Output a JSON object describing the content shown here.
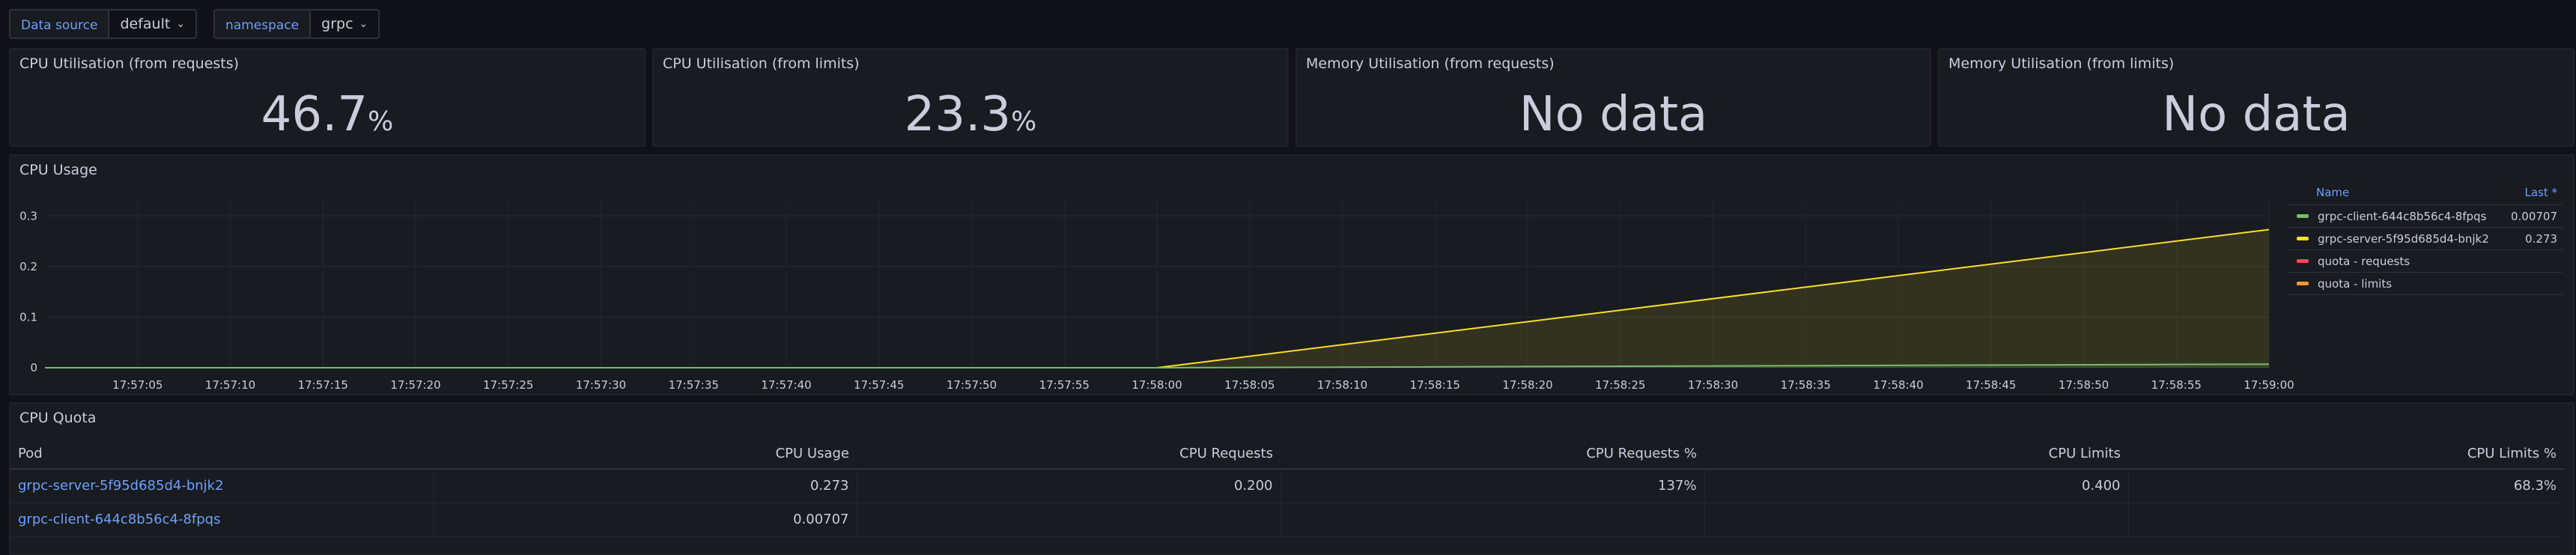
{
  "variables": [
    {
      "label": "Data source",
      "value": "default"
    },
    {
      "label": "namespace",
      "value": "grpc"
    }
  ],
  "stats": [
    {
      "title": "CPU Utilisation (from requests)",
      "value": "46.7",
      "unit": "%"
    },
    {
      "title": "CPU Utilisation (from limits)",
      "value": "23.3",
      "unit": "%"
    },
    {
      "title": "Memory Utilisation (from requests)",
      "value": "No data",
      "unit": ""
    },
    {
      "title": "Memory Utilisation (from limits)",
      "value": "No data",
      "unit": ""
    }
  ],
  "cpu_usage": {
    "title": "CPU Usage",
    "legend": {
      "name_header": "Name",
      "last_header": "Last *",
      "items": [
        {
          "name": "grpc-client-644c8b56c4-8fpqs",
          "last": "0.00707",
          "color": "#73bf69"
        },
        {
          "name": "grpc-server-5f95d685d4-bnjk2",
          "last": "0.273",
          "color": "#fade2a"
        },
        {
          "name": "quota - requests",
          "last": "",
          "color": "#f2495c"
        },
        {
          "name": "quota - limits",
          "last": "",
          "color": "#ff9830"
        }
      ]
    }
  },
  "chart_data": {
    "type": "area",
    "title": "CPU Usage",
    "x": [
      "17:57:05",
      "17:57:10",
      "17:57:15",
      "17:57:20",
      "17:57:25",
      "17:57:30",
      "17:57:35",
      "17:57:40",
      "17:57:45",
      "17:57:50",
      "17:57:55",
      "17:58:00",
      "17:58:05",
      "17:58:10",
      "17:58:15",
      "17:58:20",
      "17:58:25",
      "17:58:30",
      "17:58:35",
      "17:58:40",
      "17:58:45",
      "17:58:50",
      "17:58:55",
      "17:59:00"
    ],
    "y_ticks": [
      "0",
      "0.1",
      "0.2",
      "0.3"
    ],
    "ylim": [
      0,
      0.33
    ],
    "series": [
      {
        "name": "grpc-server-5f95d685d4-bnjk2",
        "color": "#fade2a",
        "points": [
          [
            "17:57:00",
            0
          ],
          [
            "17:58:00",
            0
          ],
          [
            "17:59:00",
            0.273
          ]
        ]
      },
      {
        "name": "grpc-client-644c8b56c4-8fpqs",
        "color": "#73bf69",
        "points": [
          [
            "17:57:00",
            0
          ],
          [
            "17:58:00",
            0
          ],
          [
            "17:59:00",
            0.00707
          ]
        ]
      }
    ]
  },
  "cpu_quota": {
    "title": "CPU Quota",
    "columns": [
      "Pod",
      "CPU Usage",
      "CPU Requests",
      "CPU Requests %",
      "CPU Limits",
      "CPU Limits %"
    ],
    "rows": [
      [
        "grpc-server-5f95d685d4-bnjk2",
        "0.273",
        "0.200",
        "137%",
        "0.400",
        "68.3%"
      ],
      [
        "grpc-client-644c8b56c4-8fpqs",
        "0.00707",
        "",
        "",
        "",
        ""
      ]
    ]
  }
}
